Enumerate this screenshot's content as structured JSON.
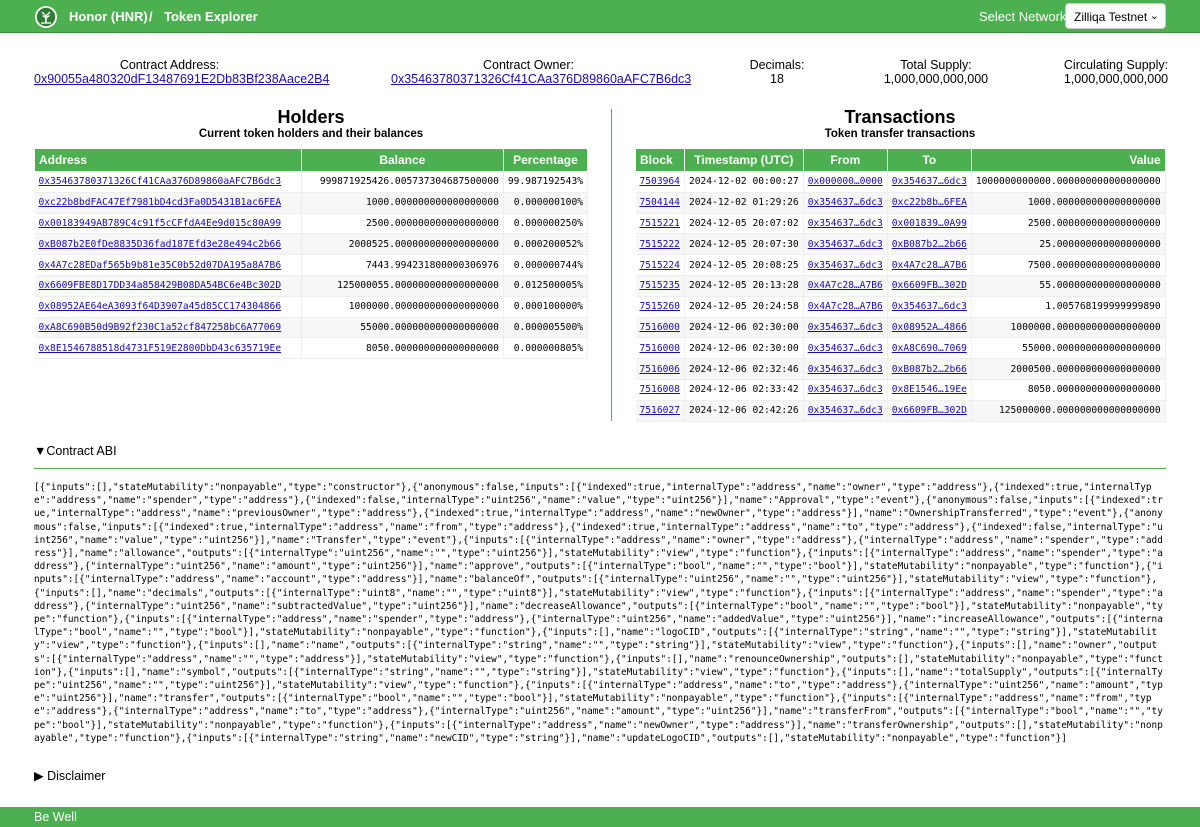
{
  "header": {
    "token_name": "Honor (HNR)",
    "separator": "/",
    "section": "Token Explorer",
    "network_label": "Select Network:",
    "network_value": "Zilliqa Testnet"
  },
  "info": {
    "contract_address_label": "Contract Address:",
    "contract_address": "0x90055a480320dF13487691E2Db83Bf238Aace2B4",
    "contract_owner_label": "Contract Owner:",
    "contract_owner": "0x35463780371326Cf41CAa376D89860aAFC7B6dc3",
    "decimals_label": "Decimals:",
    "decimals": "18",
    "total_supply_label": "Total Supply:",
    "total_supply": "1,000,000,000,000",
    "circulating_supply_label": "Circulating Supply:",
    "circulating_supply": "1,000,000,000,000"
  },
  "holders": {
    "title": "Holders",
    "subtitle": "Current token holders and their balances",
    "columns": [
      "Address",
      "Balance",
      "Percentage"
    ],
    "rows": [
      [
        "0x35463780371326Cf41CAa376D89860aAFC7B6dc3",
        "999871925426.005737304687500000",
        "99.987192543%"
      ],
      [
        "0xc22b8bdFAC47Ef7981bD4cd3Fa0D5431B1ac6FEA",
        "1000.000000000000000000",
        "0.000000100%"
      ],
      [
        "0x00183949AB789C4c91f5cCFfdA4Ee9d015c80A99",
        "2500.000000000000000000",
        "0.000000250%"
      ],
      [
        "0xB087b2E0fDe8835D36fad187Efd3e28e494c2b66",
        "2000525.000000000000000000",
        "0.000200052%"
      ],
      [
        "0x4A7c28EDaf565b9b81e35C0b52d07DA195a8A7B6",
        "7443.994231800000306976",
        "0.000000744%"
      ],
      [
        "0x6609FBE8D17DD34a858429B08DA54BC6e4Bc302D",
        "125000055.000000000000000000",
        "0.012500005%"
      ],
      [
        "0x08952AE64eA3093f64D3907a45d85CC174304866",
        "1000000.000000000000000000",
        "0.000100000%"
      ],
      [
        "0xA8C690B50d9B92f230C1a52cf847258bC6A77069",
        "55000.000000000000000000",
        "0.000005500%"
      ],
      [
        "0x8E1546788518d4731F519E2800DbD43c635719Ee",
        "8050.000000000000000000",
        "0.000000805%"
      ]
    ]
  },
  "transactions": {
    "title": "Transactions",
    "subtitle": "Token transfer transactions",
    "columns": [
      "Block",
      "Timestamp (UTC)",
      "From",
      "To",
      "Value"
    ],
    "rows": [
      [
        "7503964",
        "2024-12-02 00:00:27",
        "0x000000…0000",
        "0x354637…6dc3",
        "1000000000000.000000000000000000"
      ],
      [
        "7504144",
        "2024-12-02 01:29:26",
        "0x354637…6dc3",
        "0xc22b8b…6FEA",
        "1000.000000000000000000"
      ],
      [
        "7515221",
        "2024-12-05 20:07:02",
        "0x354637…6dc3",
        "0x001839…0A99",
        "2500.000000000000000000"
      ],
      [
        "7515222",
        "2024-12-05 20:07:30",
        "0x354637…6dc3",
        "0xB087b2…2b66",
        "25.000000000000000000"
      ],
      [
        "7515224",
        "2024-12-05 20:08:25",
        "0x354637…6dc3",
        "0x4A7c28…A7B6",
        "7500.000000000000000000"
      ],
      [
        "7515235",
        "2024-12-05 20:13:28",
        "0x4A7c28…A7B6",
        "0x6609FB…302D",
        "55.000000000000000000"
      ],
      [
        "7515260",
        "2024-12-05 20:24:58",
        "0x4A7c28…A7B6",
        "0x354637…6dc3",
        "1.005768199999999890"
      ],
      [
        "7516000",
        "2024-12-06 02:30:00",
        "0x354637…6dc3",
        "0x08952A…4866",
        "1000000.000000000000000000"
      ],
      [
        "7516000",
        "2024-12-06 02:30:00",
        "0x354637…6dc3",
        "0xA8C690…7069",
        "55000.000000000000000000"
      ],
      [
        "7516006",
        "2024-12-06 02:32:46",
        "0x354637…6dc3",
        "0xB087b2…2b66",
        "2000500.000000000000000000"
      ],
      [
        "7516008",
        "2024-12-06 02:33:42",
        "0x354637…6dc3",
        "0x8E1546…19Ee",
        "8050.000000000000000000"
      ],
      [
        "7516027",
        "2024-12-06 02:42:26",
        "0x354637…6dc3",
        "0x6609FB…302D",
        "125000000.000000000000000000"
      ]
    ]
  },
  "abi": {
    "summary": "Contract ABI",
    "text": "[{\"inputs\":[],\"stateMutability\":\"nonpayable\",\"type\":\"constructor\"},{\"anonymous\":false,\"inputs\":[{\"indexed\":true,\"internalType\":\"address\",\"name\":\"owner\",\"type\":\"address\"},{\"indexed\":true,\"internalType\":\"address\",\"name\":\"spender\",\"type\":\"address\"},{\"indexed\":false,\"internalType\":\"uint256\",\"name\":\"value\",\"type\":\"uint256\"}],\"name\":\"Approval\",\"type\":\"event\"},{\"anonymous\":false,\"inputs\":[{\"indexed\":true,\"internalType\":\"address\",\"name\":\"previousOwner\",\"type\":\"address\"},{\"indexed\":true,\"internalType\":\"address\",\"name\":\"newOwner\",\"type\":\"address\"}],\"name\":\"OwnershipTransferred\",\"type\":\"event\"},{\"anonymous\":false,\"inputs\":[{\"indexed\":true,\"internalType\":\"address\",\"name\":\"from\",\"type\":\"address\"},{\"indexed\":true,\"internalType\":\"address\",\"name\":\"to\",\"type\":\"address\"},{\"indexed\":false,\"internalType\":\"uint256\",\"name\":\"value\",\"type\":\"uint256\"}],\"name\":\"Transfer\",\"type\":\"event\"},{\"inputs\":[{\"internalType\":\"address\",\"name\":\"owner\",\"type\":\"address\"},{\"internalType\":\"address\",\"name\":\"spender\",\"type\":\"address\"}],\"name\":\"allowance\",\"outputs\":[{\"internalType\":\"uint256\",\"name\":\"\",\"type\":\"uint256\"}],\"stateMutability\":\"view\",\"type\":\"function\"},{\"inputs\":[{\"internalType\":\"address\",\"name\":\"spender\",\"type\":\"address\"},{\"internalType\":\"uint256\",\"name\":\"amount\",\"type\":\"uint256\"}],\"name\":\"approve\",\"outputs\":[{\"internalType\":\"bool\",\"name\":\"\",\"type\":\"bool\"}],\"stateMutability\":\"nonpayable\",\"type\":\"function\"},{\"inputs\":[{\"internalType\":\"address\",\"name\":\"account\",\"type\":\"address\"}],\"name\":\"balanceOf\",\"outputs\":[{\"internalType\":\"uint256\",\"name\":\"\",\"type\":\"uint256\"}],\"stateMutability\":\"view\",\"type\":\"function\"},{\"inputs\":[],\"name\":\"decimals\",\"outputs\":[{\"internalType\":\"uint8\",\"name\":\"\",\"type\":\"uint8\"}],\"stateMutability\":\"view\",\"type\":\"function\"},{\"inputs\":[{\"internalType\":\"address\",\"name\":\"spender\",\"type\":\"address\"},{\"internalType\":\"uint256\",\"name\":\"subtractedValue\",\"type\":\"uint256\"}],\"name\":\"decreaseAllowance\",\"outputs\":[{\"internalType\":\"bool\",\"name\":\"\",\"type\":\"bool\"}],\"stateMutability\":\"nonpayable\",\"type\":\"function\"},{\"inputs\":[{\"internalType\":\"address\",\"name\":\"spender\",\"type\":\"address\"},{\"internalType\":\"uint256\",\"name\":\"addedValue\",\"type\":\"uint256\"}],\"name\":\"increaseAllowance\",\"outputs\":[{\"internalType\":\"bool\",\"name\":\"\",\"type\":\"bool\"}],\"stateMutability\":\"nonpayable\",\"type\":\"function\"},{\"inputs\":[],\"name\":\"logoCID\",\"outputs\":[{\"internalType\":\"string\",\"name\":\"\",\"type\":\"string\"}],\"stateMutability\":\"view\",\"type\":\"function\"},{\"inputs\":[],\"name\":\"name\",\"outputs\":[{\"internalType\":\"string\",\"name\":\"\",\"type\":\"string\"}],\"stateMutability\":\"view\",\"type\":\"function\"},{\"inputs\":[],\"name\":\"owner\",\"outputs\":[{\"internalType\":\"address\",\"name\":\"\",\"type\":\"address\"}],\"stateMutability\":\"view\",\"type\":\"function\"},{\"inputs\":[],\"name\":\"renounceOwnership\",\"outputs\":[],\"stateMutability\":\"nonpayable\",\"type\":\"function\"},{\"inputs\":[],\"name\":\"symbol\",\"outputs\":[{\"internalType\":\"string\",\"name\":\"\",\"type\":\"string\"}],\"stateMutability\":\"view\",\"type\":\"function\"},{\"inputs\":[],\"name\":\"totalSupply\",\"outputs\":[{\"internalType\":\"uint256\",\"name\":\"\",\"type\":\"uint256\"}],\"stateMutability\":\"view\",\"type\":\"function\"},{\"inputs\":[{\"internalType\":\"address\",\"name\":\"to\",\"type\":\"address\"},{\"internalType\":\"uint256\",\"name\":\"amount\",\"type\":\"uint256\"}],\"name\":\"transfer\",\"outputs\":[{\"internalType\":\"bool\",\"name\":\"\",\"type\":\"bool\"}],\"stateMutability\":\"nonpayable\",\"type\":\"function\"},{\"inputs\":[{\"internalType\":\"address\",\"name\":\"from\",\"type\":\"address\"},{\"internalType\":\"address\",\"name\":\"to\",\"type\":\"address\"},{\"internalType\":\"uint256\",\"name\":\"amount\",\"type\":\"uint256\"}],\"name\":\"transferFrom\",\"outputs\":[{\"internalType\":\"bool\",\"name\":\"\",\"type\":\"bool\"}],\"stateMutability\":\"nonpayable\",\"type\":\"function\"},{\"inputs\":[{\"internalType\":\"address\",\"name\":\"newOwner\",\"type\":\"address\"}],\"name\":\"transferOwnership\",\"outputs\":[],\"stateMutability\":\"nonpayable\",\"type\":\"function\"},{\"inputs\":[{\"internalType\":\"string\",\"name\":\"newCID\",\"type\":\"string\"}],\"name\":\"updateLogoCID\",\"outputs\":[],\"stateMutability\":\"nonpayable\",\"type\":\"function\"}]"
  },
  "disclaimer": {
    "summary": "Disclaimer"
  },
  "footer": {
    "text": "Be Well"
  },
  "colors": {
    "accent": "#4caf50",
    "link": "#1a0dab"
  },
  "icons": {
    "logo": "tree-logo-icon",
    "abi_toggle": "triangle-down-icon",
    "disclaimer_toggle": "triangle-right-icon",
    "select_chevron": "chevron-down-icon"
  }
}
